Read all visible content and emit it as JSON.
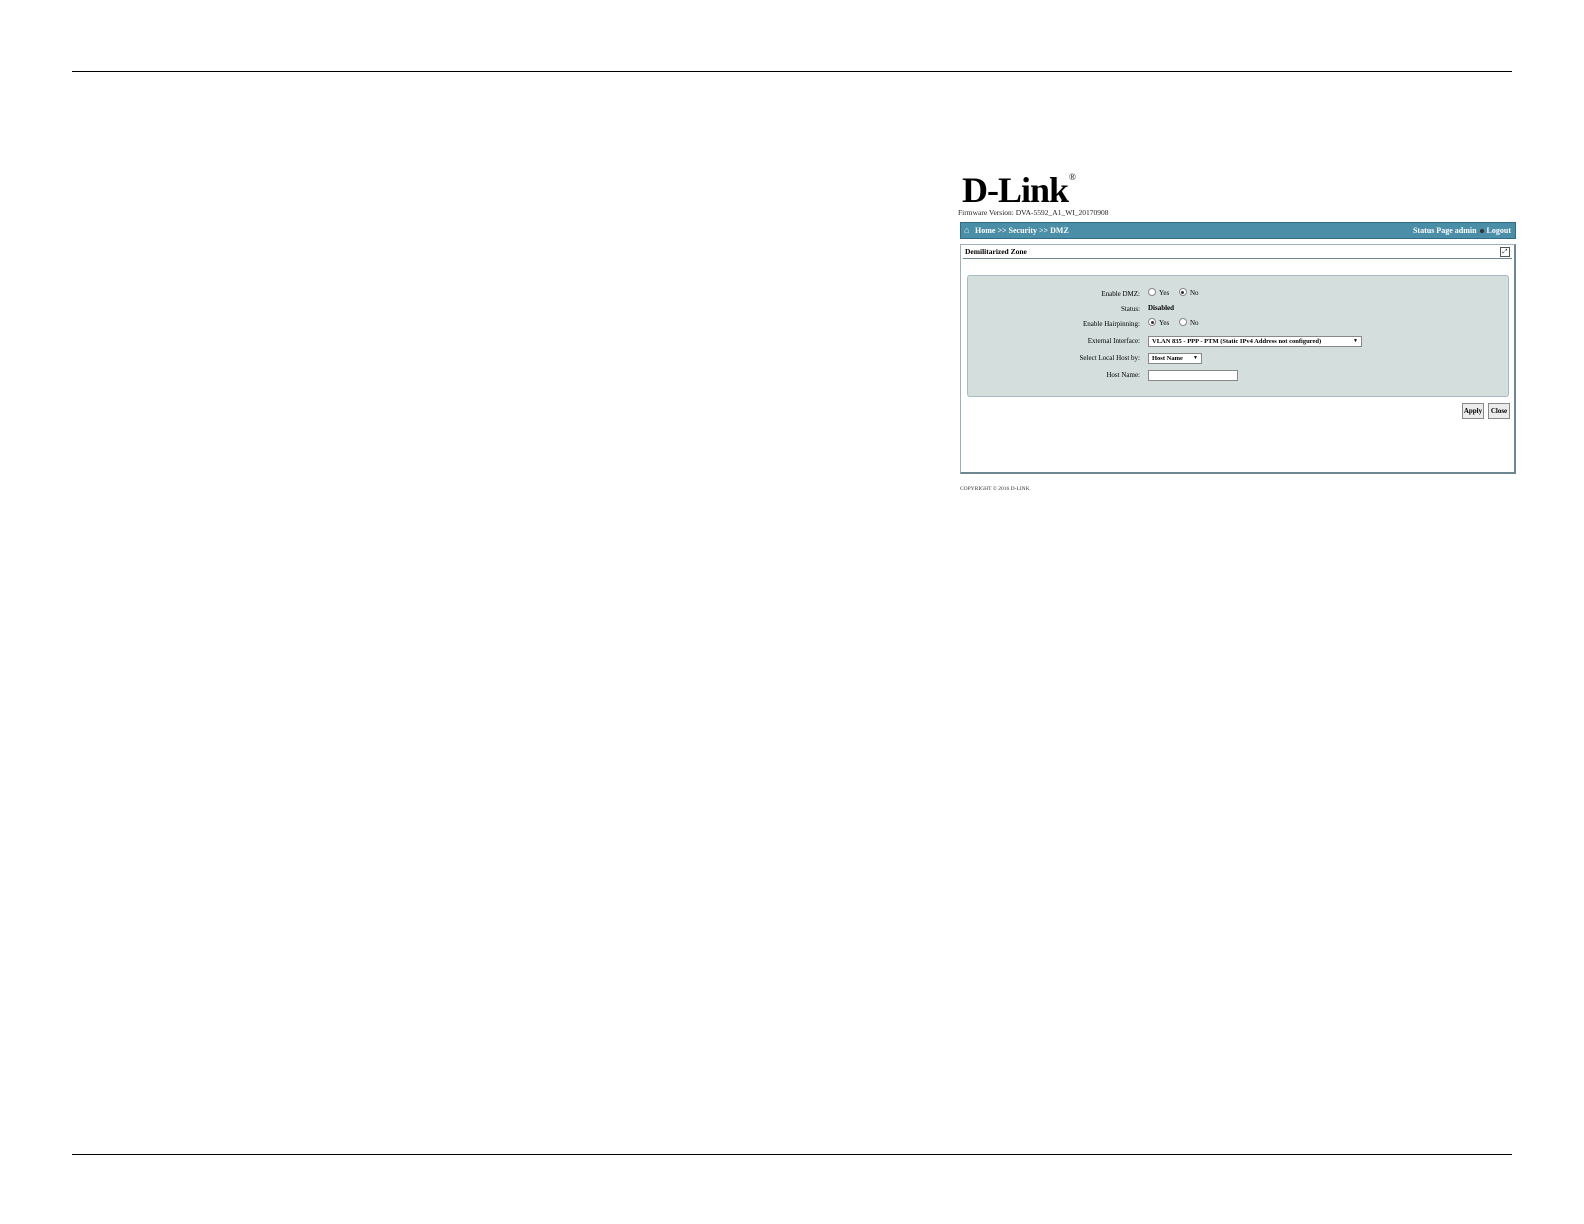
{
  "brand": {
    "logo_text": "D-Link",
    "registered_mark": "®"
  },
  "firmware": "Firmware Version: DVA-5592_A1_WI_20170908",
  "navbar": {
    "breadcrumb": "Home >> Security >> DMZ",
    "status_page": "Status Page",
    "user": "admin",
    "logout": "Logout"
  },
  "panel": {
    "title": "Demilitarized Zone",
    "fields": {
      "enable_dmz": {
        "label": "Enable DMZ:",
        "options": [
          "Yes",
          "No"
        ],
        "selected": "No"
      },
      "status": {
        "label": "Status:",
        "value": "Disabled"
      },
      "enable_hairpinning": {
        "label": "Enable Hairpinning:",
        "options": [
          "Yes",
          "No"
        ],
        "selected": "Yes"
      },
      "external_interface": {
        "label": "External Interface:",
        "value": "VLAN 835 - PPP - PTM (Static IPv4 Address not configured)"
      },
      "select_local_host": {
        "label": "Select Local Host by:",
        "value": "Host Name"
      },
      "host_name": {
        "label": "Host Name:",
        "value": ""
      }
    },
    "buttons": {
      "apply": "Apply",
      "close": "Close"
    }
  },
  "copyright": "COPYRIGHT © 2016 D-LINK"
}
